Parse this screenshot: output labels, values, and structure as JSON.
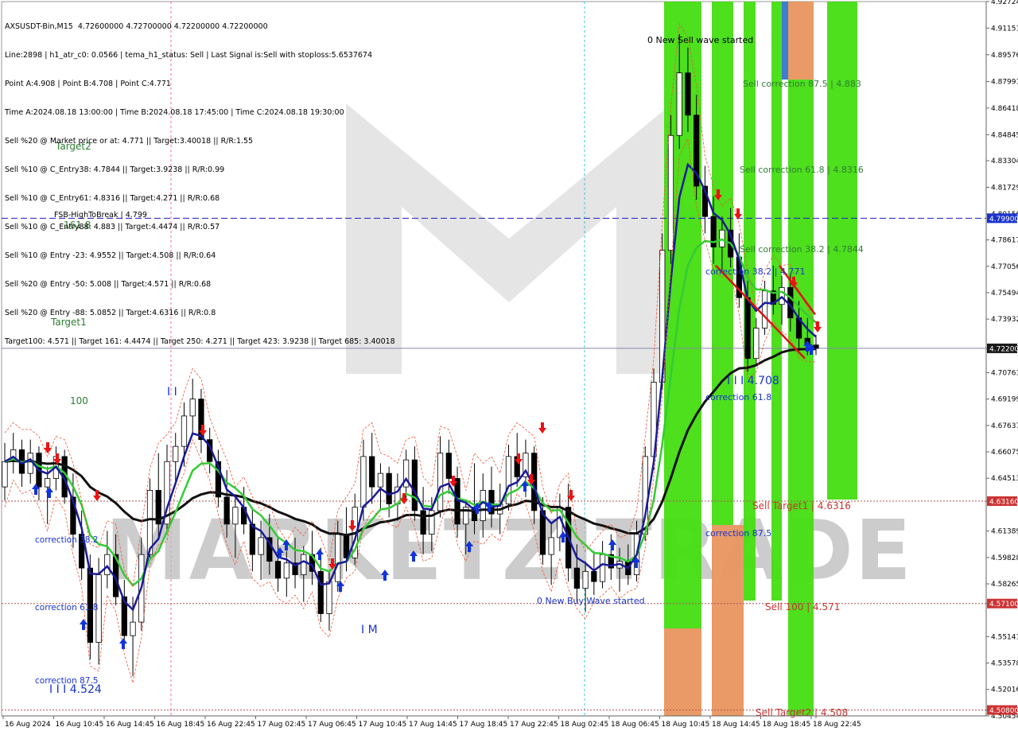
{
  "chart_data": {
    "type": "candlestick",
    "symbol_header": "AXSUSDT-Bin,M15  4.72600000 4.72700000 4.72200000 4.72200000",
    "info_lines": [
      "Line:2898 | h1_atr_c0: 0.0566 | tema_h1_status: Sell | Last Signal is:Sell with stoploss:5.6537674",
      "Point A:4.908 | Point B:4.708 | Point C:4.771",
      "Time A:2024.08.18 13:00:00 | Time B:2024.08.18 17:45:00 | Time C:2024.08.18 19:30:00",
      "Sell %20 @ Market price or at: 4.771 || Target:3.40018 || R/R:1.55",
      "Sell %10 @ C_Entry38: 4.7844 || Target:3.9238 || R/R:0.99",
      "Sell %10 @ C_Entry61: 4.8316 || Target:4.271 || R/R:0.68",
      "Sell %10 @ C_Entry88: 4.883 || Target:4.4474 || R/R:0.57",
      "Sell %10 @ Entry -23: 4.9552 || Target:4.508 || R/R:0.64",
      "Sell %20 @ Entry -50: 5.008 || Target:4.571 || R/R:0.68",
      "Sell %20 @ Entry -88: 5.0852 || Target:4.6316 || R/R:0.8",
      "Target100: 4.571 || Target 161: 4.4474 || Target 250: 4.271 || Target 423: 3.9238 || Target 685: 3.40018"
    ],
    "y_ticks": [
      "4.92724",
      "4.91151",
      "4.89576",
      "4.87991",
      "4.86418",
      "4.84845",
      "4.83304",
      "4.81729",
      "4.80156",
      "4.78617",
      "4.77056",
      "4.75494",
      "4.73932",
      "4.72200",
      "4.70761",
      "4.69199",
      "4.67637",
      "4.66075",
      "4.64513",
      "4.63160",
      "4.61389",
      "4.59828",
      "4.58265",
      "4.57100",
      "4.55141",
      "4.53578",
      "4.52016",
      "4.50800",
      "4.50454"
    ],
    "ylim": [
      4.5045,
      4.9272
    ],
    "x_labels": [
      "16 Aug 2024",
      "16 Aug 10:45",
      "16 Aug 14:45",
      "16 Aug 18:45",
      "16 Aug 22:45",
      "17 Aug 02:45",
      "17 Aug 06:45",
      "17 Aug 10:45",
      "17 Aug 14:45",
      "17 Aug 18:45",
      "17 Aug 22:45",
      "18 Aug 02:45",
      "18 Aug 06:45",
      "18 Aug 10:45",
      "18 Aug 14:45",
      "18 Aug 18:45",
      "18 Aug 22:45"
    ],
    "price_badges": [
      {
        "value": 4.799,
        "text": "4.79900",
        "color": "#1a33cc"
      },
      {
        "value": 4.722,
        "text": "4.72200",
        "color": "#1a1a1a"
      },
      {
        "value": 4.6316,
        "text": "4.63160",
        "color": "#cc3333"
      },
      {
        "value": 4.571,
        "text": "4.57100",
        "color": "#cc3333"
      },
      {
        "value": 4.508,
        "text": "4.50800",
        "color": "#cc3333"
      }
    ],
    "horizontal_lines": [
      {
        "value": 4.799,
        "color": "#1a1acc",
        "style": "dash"
      },
      {
        "value": 4.722,
        "color": "#8888aa",
        "style": "solid"
      },
      {
        "value": 4.6316,
        "color": "#b05050",
        "style": "dot"
      },
      {
        "value": 4.571,
        "color": "#b05050",
        "style": "dot"
      },
      {
        "value": 4.508,
        "color": "#b05050",
        "style": "dot"
      }
    ],
    "annotations": {
      "target2": "Target2",
      "fsb": "FSB-HighToBreak | 4.799",
      "fib_161": "161.8",
      "target1": "Target1",
      "fib_100": "100",
      "corr_left_382": "correction 38.2",
      "corr_left_618": "correction 61.8",
      "corr_left_875": "correction 87.5",
      "left_wave_label": "I I I 4.524",
      "im_label": "I M",
      "new_buy_wave": "0 New Buy Wave started",
      "new_sell_wave": "0 New Sell wave started",
      "sell_corr_875": "Sell correction 87.5 | 4.883",
      "sell_corr_618": "Sell correction 61.8 | 4.8316",
      "sell_corr_382": "Sell correction 38.2 | 4.7844",
      "point_c_label": "correction 38.2 | 4.771",
      "point_b_label": "I I I 4.708",
      "corr_right_618": "correction 61.8",
      "corr_right_875": "correction 87.5",
      "sell_target1": "Sell Target1 | 4.6316",
      "sell_100": "Sell 100 | 4.571",
      "sell_target2": "Sell Target2 | 4.508",
      "peak_ii": "I I",
      "watermark": "MARKETZITRADE"
    },
    "candles": [
      [
        4.64,
        4.666,
        4.632,
        4.655
      ],
      [
        4.655,
        4.672,
        4.648,
        4.662
      ],
      [
        4.662,
        4.668,
        4.64,
        4.648
      ],
      [
        4.648,
        4.668,
        4.642,
        4.66
      ],
      [
        4.66,
        4.664,
        4.632,
        4.64
      ],
      [
        4.64,
        4.652,
        4.618,
        4.645
      ],
      [
        4.645,
        4.664,
        4.638,
        4.658
      ],
      [
        4.658,
        4.662,
        4.63,
        4.634
      ],
      [
        4.634,
        4.648,
        4.604,
        4.612
      ],
      [
        4.612,
        4.626,
        4.585,
        4.592
      ],
      [
        4.592,
        4.6,
        4.538,
        4.548
      ],
      [
        4.548,
        4.598,
        4.535,
        4.588
      ],
      [
        4.588,
        4.614,
        4.58,
        4.6
      ],
      [
        4.6,
        4.612,
        4.57,
        4.575
      ],
      [
        4.575,
        4.585,
        4.545,
        4.552
      ],
      [
        4.552,
        4.575,
        4.528,
        4.56
      ],
      [
        4.56,
        4.61,
        4.555,
        4.6
      ],
      [
        4.6,
        4.645,
        4.598,
        4.638
      ],
      [
        4.638,
        4.66,
        4.61,
        4.618
      ],
      [
        4.618,
        4.665,
        4.612,
        4.655
      ],
      [
        4.655,
        4.672,
        4.642,
        4.664
      ],
      [
        4.664,
        4.69,
        4.652,
        4.682
      ],
      [
        4.682,
        4.704,
        4.672,
        4.692
      ],
      [
        4.692,
        4.698,
        4.66,
        4.668
      ],
      [
        4.668,
        4.675,
        4.648,
        4.655
      ],
      [
        4.655,
        4.662,
        4.628,
        4.634
      ],
      [
        4.634,
        4.65,
        4.61,
        4.618
      ],
      [
        4.618,
        4.634,
        4.598,
        4.628
      ],
      [
        4.628,
        4.64,
        4.612,
        4.618
      ],
      [
        4.618,
        4.628,
        4.59,
        4.6
      ],
      [
        4.6,
        4.62,
        4.585,
        4.61
      ],
      [
        4.61,
        4.624,
        4.588,
        4.596
      ],
      [
        4.596,
        4.61,
        4.578,
        4.586
      ],
      [
        4.586,
        4.602,
        4.575,
        4.595
      ],
      [
        4.595,
        4.61,
        4.58,
        4.588
      ],
      [
        4.588,
        4.605,
        4.572,
        4.6
      ],
      [
        4.6,
        4.614,
        4.582,
        4.59
      ],
      [
        4.59,
        4.604,
        4.56,
        4.565
      ],
      [
        4.565,
        4.59,
        4.555,
        4.584
      ],
      [
        4.584,
        4.62,
        4.578,
        4.612
      ],
      [
        4.612,
        4.628,
        4.59,
        4.598
      ],
      [
        4.598,
        4.636,
        4.594,
        4.628
      ],
      [
        4.628,
        4.668,
        4.62,
        4.658
      ],
      [
        4.658,
        4.672,
        4.63,
        4.64
      ],
      [
        4.64,
        4.654,
        4.626,
        4.648
      ],
      [
        4.648,
        4.652,
        4.622,
        4.63
      ],
      [
        4.63,
        4.648,
        4.62,
        4.64
      ],
      [
        4.64,
        4.662,
        4.632,
        4.656
      ],
      [
        4.656,
        4.664,
        4.62,
        4.626
      ],
      [
        4.626,
        4.64,
        4.6,
        4.612
      ],
      [
        4.612,
        4.634,
        4.602,
        4.626
      ],
      [
        4.626,
        4.67,
        4.622,
        4.66
      ],
      [
        4.66,
        4.668,
        4.636,
        4.645
      ],
      [
        4.645,
        4.652,
        4.61,
        4.618
      ],
      [
        4.618,
        4.632,
        4.6,
        4.628
      ],
      [
        4.628,
        4.654,
        4.612,
        4.62
      ],
      [
        4.62,
        4.648,
        4.61,
        4.638
      ],
      [
        4.638,
        4.652,
        4.616,
        4.624
      ],
      [
        4.624,
        4.642,
        4.612,
        4.63
      ],
      [
        4.63,
        4.665,
        4.626,
        4.658
      ],
      [
        4.658,
        4.672,
        4.64,
        4.646
      ],
      [
        4.646,
        4.668,
        4.634,
        4.66
      ],
      [
        4.66,
        4.664,
        4.618,
        4.626
      ],
      [
        4.626,
        4.634,
        4.594,
        4.6
      ],
      [
        4.6,
        4.618,
        4.582,
        4.61
      ],
      [
        4.61,
        4.636,
        4.602,
        4.628
      ],
      [
        4.628,
        4.642,
        4.584,
        4.592
      ],
      [
        4.592,
        4.606,
        4.572,
        4.58
      ],
      [
        4.58,
        4.596,
        4.566,
        4.59
      ],
      [
        4.59,
        4.602,
        4.576,
        4.584
      ],
      [
        4.584,
        4.608,
        4.58,
        4.6
      ],
      [
        4.6,
        4.612,
        4.585,
        4.592
      ],
      [
        4.592,
        4.604,
        4.578,
        4.596
      ],
      [
        4.596,
        4.606,
        4.582,
        4.588
      ],
      [
        4.588,
        4.62,
        4.584,
        4.612
      ],
      [
        4.612,
        4.664,
        4.608,
        4.658
      ],
      [
        4.658,
        4.71,
        4.65,
        4.702
      ],
      [
        4.702,
        4.79,
        4.698,
        4.78
      ],
      [
        4.78,
        4.86,
        4.772,
        4.848
      ],
      [
        4.848,
        4.908,
        4.84,
        4.885
      ],
      [
        4.885,
        4.9,
        4.85,
        4.86
      ],
      [
        4.86,
        4.872,
        4.81,
        4.818
      ],
      [
        4.818,
        4.83,
        4.79,
        4.8
      ],
      [
        4.8,
        4.812,
        4.772,
        4.782
      ],
      [
        4.782,
        4.8,
        4.768,
        4.792
      ],
      [
        4.792,
        4.805,
        4.77,
        4.776
      ],
      [
        4.776,
        4.79,
        4.746,
        4.752
      ],
      [
        4.752,
        4.762,
        4.708,
        4.716
      ],
      [
        4.716,
        4.74,
        4.712,
        4.734
      ],
      [
        4.734,
        4.762,
        4.73,
        4.756
      ],
      [
        4.756,
        4.771,
        4.742,
        4.748
      ],
      [
        4.748,
        4.765,
        4.736,
        4.758
      ],
      [
        4.758,
        4.766,
        4.732,
        4.74
      ],
      [
        4.74,
        4.75,
        4.72,
        4.728
      ],
      [
        4.728,
        4.74,
        4.718,
        4.724
      ],
      [
        4.724,
        4.73,
        4.718,
        4.722
      ]
    ]
  }
}
